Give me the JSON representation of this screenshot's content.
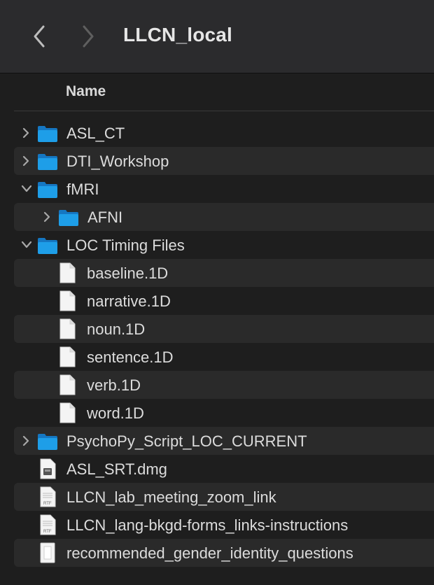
{
  "window": {
    "title": "LLCN_local"
  },
  "columns": {
    "name": "Name"
  },
  "rows": [
    {
      "label": "ASL_CT",
      "kind": "folder",
      "depth": 0,
      "disclosure": "collapsed"
    },
    {
      "label": "DTI_Workshop",
      "kind": "folder",
      "depth": 0,
      "disclosure": "collapsed"
    },
    {
      "label": "fMRI",
      "kind": "folder",
      "depth": 0,
      "disclosure": "expanded"
    },
    {
      "label": "AFNI",
      "kind": "folder",
      "depth": 1,
      "disclosure": "collapsed"
    },
    {
      "label": "LOC Timing Files",
      "kind": "folder",
      "depth": 0,
      "disclosure": "expanded"
    },
    {
      "label": "baseline.1D",
      "kind": "file",
      "depth": 1
    },
    {
      "label": "narrative.1D",
      "kind": "file",
      "depth": 1
    },
    {
      "label": "noun.1D",
      "kind": "file",
      "depth": 1
    },
    {
      "label": "sentence.1D",
      "kind": "file",
      "depth": 1
    },
    {
      "label": "verb.1D",
      "kind": "file",
      "depth": 1
    },
    {
      "label": "word.1D",
      "kind": "file",
      "depth": 1
    },
    {
      "label": "PsychoPy_Script_LOC_CURRENT",
      "kind": "folder",
      "depth": 0,
      "disclosure": "collapsed"
    },
    {
      "label": "ASL_SRT.dmg",
      "kind": "dmg",
      "depth": 0
    },
    {
      "label": "LLCN_lab_meeting_zoom_link",
      "kind": "rtf",
      "depth": 0,
      "badge": "RTF"
    },
    {
      "label": "LLCN_lang-bkgd-forms_links-instructions",
      "kind": "rtf",
      "depth": 0,
      "badge": "RTF"
    },
    {
      "label": "recommended_gender_identity_questions",
      "kind": "doc",
      "depth": 0
    }
  ],
  "colors": {
    "folder": "#1e9ee8",
    "folder_dark": "#1577c2",
    "file": "#f2f2f2",
    "alt_row": "#2a2a2a"
  }
}
